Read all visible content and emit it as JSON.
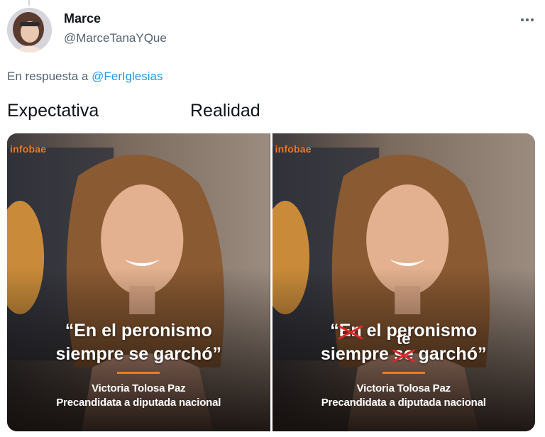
{
  "tweet": {
    "author_name": "Marce",
    "author_handle": "@MarceTanaYQue",
    "reply_prefix": "En respuesta a",
    "reply_mention": "@FerIglesias",
    "caption_left": "Expectativa",
    "caption_right": "Realidad"
  },
  "media": {
    "left": {
      "brand": "infobae",
      "quote_line1": "“En el peronismo",
      "quote_line2": "siempre se garchó”",
      "credit_name": "Victoria Tolosa Paz",
      "credit_role": "Precandidata a diputada nacional"
    },
    "right": {
      "brand": "infobae",
      "quote_open": "“",
      "quote_struck1": "En",
      "quote_rest1": " el peronismo",
      "quote_pre2": "siempre ",
      "quote_struck2": "se",
      "quote_insert2": "te",
      "quote_post2": " garchó”",
      "credit_name": "Victoria Tolosa Paz",
      "credit_role": "Precandidata a diputada nacional"
    }
  },
  "colors": {
    "brand_orange": "#f07b1e",
    "strike_red": "#e0262a",
    "link_blue": "#1d9bf0",
    "secondary_text": "#536471"
  },
  "icons": {
    "more": "more-options-icon"
  }
}
